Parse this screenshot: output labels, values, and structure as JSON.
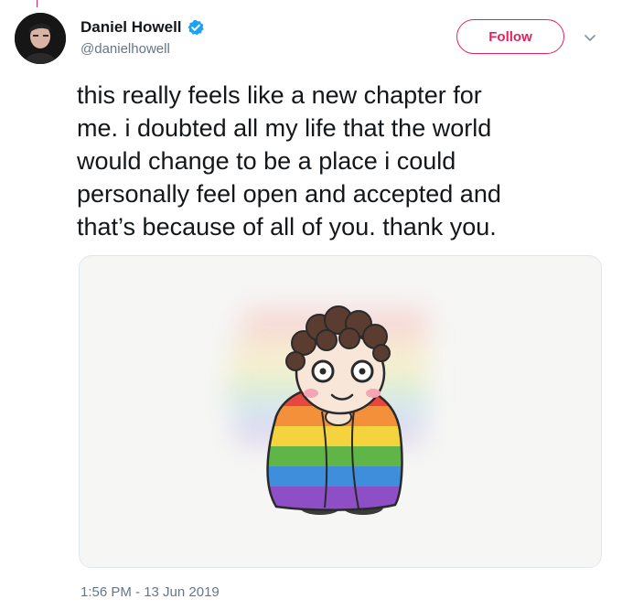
{
  "author": {
    "name": "Daniel Howell",
    "handle": "@danielhowell",
    "verified": true
  },
  "follow_button": {
    "label": "Follow"
  },
  "tweet": {
    "text": "this really feels like a new chapter for\nme. i doubted all my life that the world\nwould change to be a place i could\npersonally feel open and accepted and\nthat’s because of all of you. thank you.",
    "timestamp": "1:56 PM - 13 Jun 2019"
  },
  "media": {
    "description_icon": "cartoon-rainbow-blanket-illustration"
  },
  "icons": {
    "verified": "verified-badge-icon",
    "caret": "chevron-down-icon"
  },
  "colors": {
    "accent": "#e0245e",
    "verified": "#1da1f2",
    "muted": "#657786",
    "text": "#14171a"
  }
}
